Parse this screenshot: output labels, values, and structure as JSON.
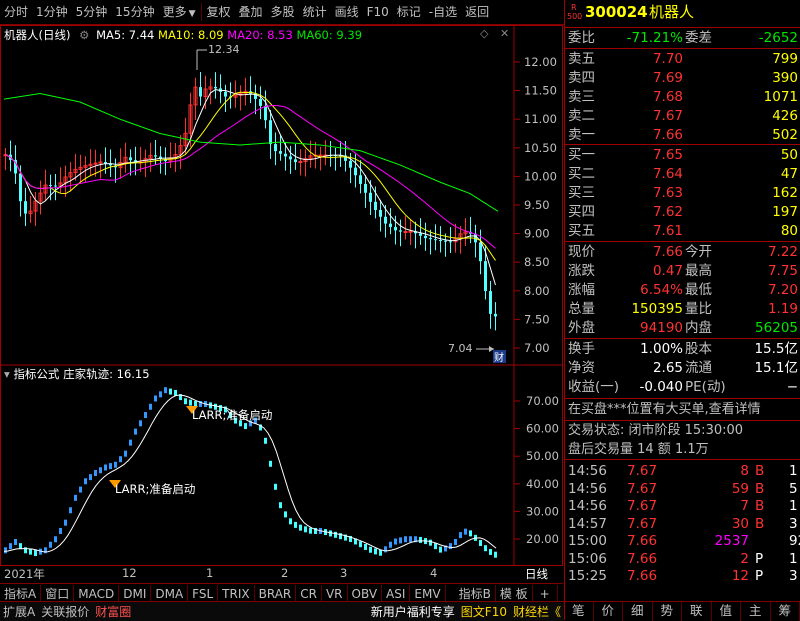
{
  "toolbar": {
    "items": [
      "分时",
      "1分钟",
      "5分钟",
      "15分钟",
      "更多",
      "复权",
      "叠加",
      "多股",
      "统计",
      "画线",
      "F10",
      "标记",
      "-自选",
      "返回"
    ]
  },
  "main_chart": {
    "title": "机器人(日线)",
    "ma5": "MA5: 7.44",
    "ma10": "MA10: 8.09",
    "ma20": "MA20: 8.53",
    "ma60": "MA60: 9.39",
    "high_label": "12.34",
    "low_label": "7.04",
    "fin_badge": "财",
    "price_axis": [
      "12.00",
      "11.50",
      "11.00",
      "10.50",
      "10.00",
      "9.50",
      "9.00",
      "8.50",
      "8.00",
      "7.50",
      "7.00"
    ],
    "colors": {
      "ma5": "#ffffff",
      "ma10": "#ffff00",
      "ma20": "#ff00ff",
      "ma60": "#00ff00",
      "up": "#ff3232",
      "down": "#54ffff"
    }
  },
  "indicator": {
    "title": "指标公式 庄家轨迹: 16.15",
    "axis": [
      "70.00",
      "60.00",
      "50.00",
      "40.00",
      "30.00",
      "20.00"
    ],
    "signal1": "LARR;准备启动",
    "signal2": "LARR;准备启动"
  },
  "dates": {
    "labels": [
      "2021年",
      "12",
      "1",
      "2",
      "3",
      "4"
    ],
    "right": "日线"
  },
  "tabs": [
    "指标A",
    "窗口",
    "MACD",
    "DMI",
    "DMA",
    "FSL",
    "TRIX",
    "BRAR",
    "CR",
    "VR",
    "OBV",
    "ASI",
    "EMV",
    "",
    "指标B",
    "模 板",
    "+",
    "-"
  ],
  "bottom_bar": [
    "扩展A",
    "关联报价",
    "财富圈",
    "新用户福利专享",
    "图文F10",
    "财经栏《"
  ],
  "stock": {
    "badge_top": "R",
    "badge_bottom": "500",
    "code": "300024",
    "name": "机器人"
  },
  "weibi": {
    "label1": "委比",
    "val1": "-71.21%",
    "label2": "委差",
    "val2": "-2652"
  },
  "asks": [
    {
      "label": "卖五",
      "price": "7.70",
      "vol": "799"
    },
    {
      "label": "卖四",
      "price": "7.69",
      "vol": "390"
    },
    {
      "label": "卖三",
      "price": "7.68",
      "vol": "1071"
    },
    {
      "label": "卖二",
      "price": "7.67",
      "vol": "426"
    },
    {
      "label": "卖一",
      "price": "7.66",
      "vol": "502"
    }
  ],
  "bids": [
    {
      "label": "买一",
      "price": "7.65",
      "vol": "50"
    },
    {
      "label": "买二",
      "price": "7.64",
      "vol": "47"
    },
    {
      "label": "买三",
      "price": "7.63",
      "vol": "162"
    },
    {
      "label": "买四",
      "price": "7.62",
      "vol": "197"
    },
    {
      "label": "买五",
      "price": "7.61",
      "vol": "80"
    }
  ],
  "quote": [
    {
      "l1": "现价",
      "v1": "7.66",
      "l2": "今开",
      "v2": "7.22"
    },
    {
      "l1": "涨跌",
      "v1": "0.47",
      "l2": "最高",
      "v2": "7.75"
    },
    {
      "l1": "涨幅",
      "v1": "6.54%",
      "l2": "最低",
      "v2": "7.20"
    },
    {
      "l1": "总量",
      "v1": "150395",
      "l2": "量比",
      "v2": "1.19"
    },
    {
      "l1": "外盘",
      "v1": "94190",
      "l2": "内盘",
      "v2": "56205"
    }
  ],
  "stats": [
    {
      "l1": "换手",
      "v1": "1.00%",
      "l2": "股本",
      "v2": "15.5亿"
    },
    {
      "l1": "净资",
      "v1": "2.65",
      "l2": "流通",
      "v2": "15.1亿"
    },
    {
      "l1": "收益(一)",
      "v1": "-0.040",
      "l2": "PE(动)",
      "v2": "−"
    }
  ],
  "info": {
    "notice": "在买盘***位置有大买单,查看详情",
    "status_label": "交易状态: 闭市阶段 15:30:00",
    "after_hours": "盘后交易量 14 额 1.1万"
  },
  "ticks": [
    {
      "time": "14:56",
      "price": "7.67",
      "vol": "8",
      "bs": "B",
      "n": "1"
    },
    {
      "time": "14:56",
      "price": "7.67",
      "vol": "59",
      "bs": "B",
      "n": "5"
    },
    {
      "time": "14:56",
      "price": "7.67",
      "vol": "7",
      "bs": "B",
      "n": "1"
    },
    {
      "time": "14:57",
      "price": "7.67",
      "vol": "30",
      "bs": "B",
      "n": "3"
    },
    {
      "time": "15:00",
      "price": "7.66",
      "vol": "2537",
      "bs": "",
      "n": "92"
    },
    {
      "time": "15:06",
      "price": "7.66",
      "vol": "2",
      "bs": "P",
      "n": "1"
    },
    {
      "time": "15:25",
      "price": "7.66",
      "vol": "12",
      "bs": "P",
      "n": "3"
    }
  ],
  "right_tabs": [
    "笔",
    "价",
    "细",
    "势",
    "联",
    "值",
    "主",
    "筹"
  ]
}
